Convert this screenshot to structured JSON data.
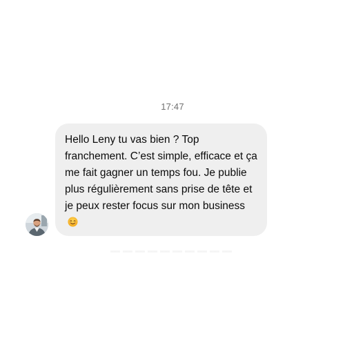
{
  "conversation": {
    "timestamp": "17:47",
    "message": {
      "text": "Hello Leny tu vas bien ? Top franchement. C’est simple, efficace et ça me fait gagner un temps fou. Je publie plus régulièrement sans prise de tête et je peux rester focus sur mon business",
      "emoji": "smiling-face-icon",
      "bubble_color": "#efefef"
    },
    "sender_avatar": "avatar"
  }
}
